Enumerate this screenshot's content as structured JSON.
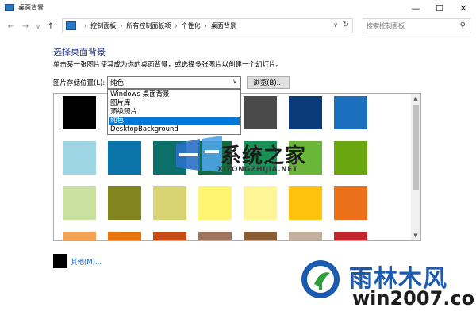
{
  "window": {
    "title": "桌面背景",
    "controls": {
      "minimize": "—",
      "maximize": "☐",
      "close": "✕"
    }
  },
  "nav": {
    "back": "←",
    "forward": "→",
    "recent": "∨",
    "up": "↑",
    "breadcrumbs": [
      "控制面板",
      "所有控制面板项",
      "个性化",
      "桌面背景"
    ],
    "separator": "›",
    "search_placeholder": "搜索控制面板"
  },
  "content": {
    "heading": "选择桌面背景",
    "subtitle": "单击某一张图片使其成为你的桌面背景，或选择多张图片以创建一个幻灯片。",
    "location_label": "图片存储位置(L):",
    "location_value": "纯色",
    "browse_label": "浏览(B)...",
    "dropdown_options": [
      "Windows 桌面背景",
      "图片库",
      "顶级照片",
      "纯色",
      "DesktopBackground"
    ],
    "dropdown_selected_index": 3,
    "swatch_rows": [
      [
        "#000000",
        "#7a7a7a",
        "#a8a8a8",
        "#c8c8c8",
        "#4a4a4a",
        "#0b3a78",
        "#1c6fbd"
      ],
      [
        "#9fd6e6",
        "#0b74a9",
        "#0c6f6a",
        "#106f3d",
        "#189156",
        "#69b638",
        "#6aa60f"
      ],
      [
        "#c8e0a0",
        "#838520",
        "#d8d474",
        "#fff570",
        "#fff496",
        "#ffc20e",
        "#ec6f1a"
      ],
      [
        "#f5a455",
        "#e6750e",
        "#c74b14",
        "#9f7560",
        "#8a5d34",
        "#c3b39e",
        "#c1272d"
      ]
    ],
    "other_label": "其他(M)...",
    "other_color": "#000000"
  },
  "watermarks": {
    "center_title": "系统之家",
    "center_sub": "XITONGZHIJIA.NET",
    "corner_title": "雨林木风",
    "corner_sub": "win2007.com"
  },
  "colors": {
    "accent": "#0078d7",
    "heading": "#1e3287",
    "link": "#0066cc"
  }
}
